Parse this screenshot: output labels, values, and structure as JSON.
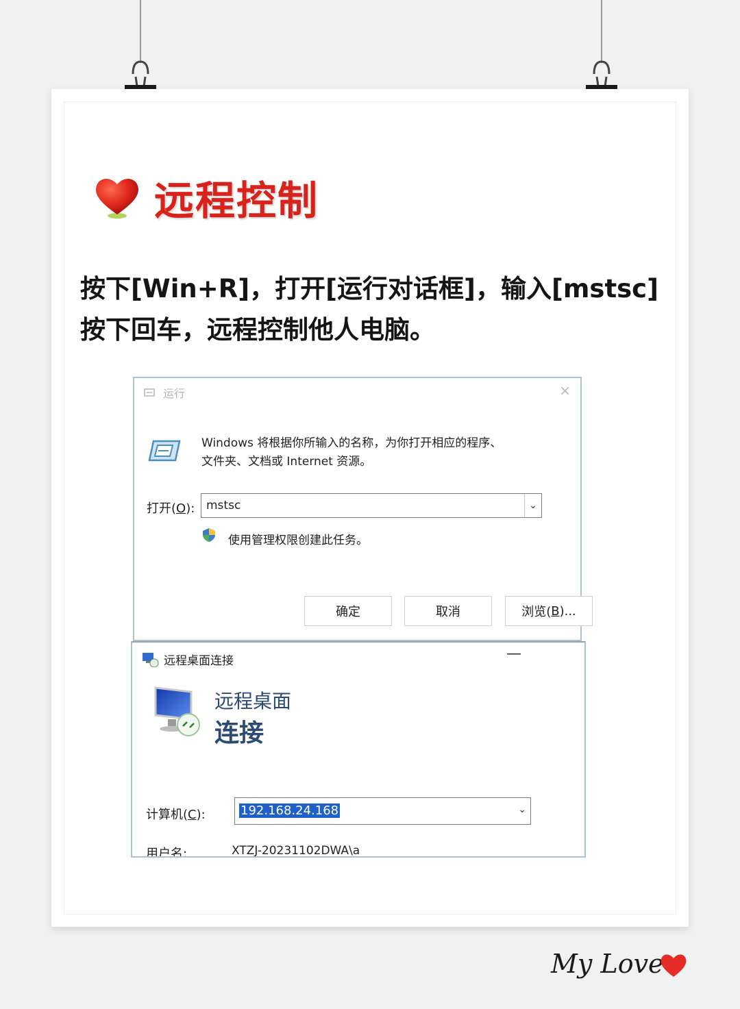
{
  "heading": {
    "title": "远程控制"
  },
  "description": {
    "line1": "按下[Win+R]，打开[运行对话框]，输入[mstsc]",
    "line2": "按下回车，远程控制他人电脑。"
  },
  "run_dialog": {
    "title": "运行",
    "close_icon": "×",
    "message_line1": "Windows 将根据你所输入的名称，为你打开相应的程序、",
    "message_line2": "文件夹、文档或 Internet 资源。",
    "open_label_pre": "打开(",
    "open_label_key": "O",
    "open_label_post": "):",
    "open_value": "mstsc",
    "admin_text": "使用管理权限创建此任务。",
    "buttons": {
      "ok": "确定",
      "cancel": "取消",
      "browse_pre": "浏览(",
      "browse_key": "B",
      "browse_post": ")..."
    }
  },
  "rdp_dialog": {
    "title": "远程桌面连接",
    "minimize_icon": "—",
    "heading_line1": "远程桌面",
    "heading_line2": "连接",
    "computer_label_pre": "计算机(",
    "computer_label_key": "C",
    "computer_label_post": "):",
    "computer_value": "192.168.24.168",
    "user_label": "用户名:",
    "user_value": "XTZJ-20231102DWA\\a"
  },
  "signature": {
    "text": "My Love"
  },
  "colors": {
    "accent_red": "#d8231c",
    "rdp_heading": "#2b4a74",
    "selection": "#1f61c8"
  },
  "icons": [
    "heart-icon",
    "run-app-icon",
    "run-window-icon",
    "close-icon",
    "shield-icon",
    "chevron-down-icon",
    "rdp-app-icon",
    "minimize-icon",
    "monitor-icon",
    "binder-clip-icon"
  ]
}
